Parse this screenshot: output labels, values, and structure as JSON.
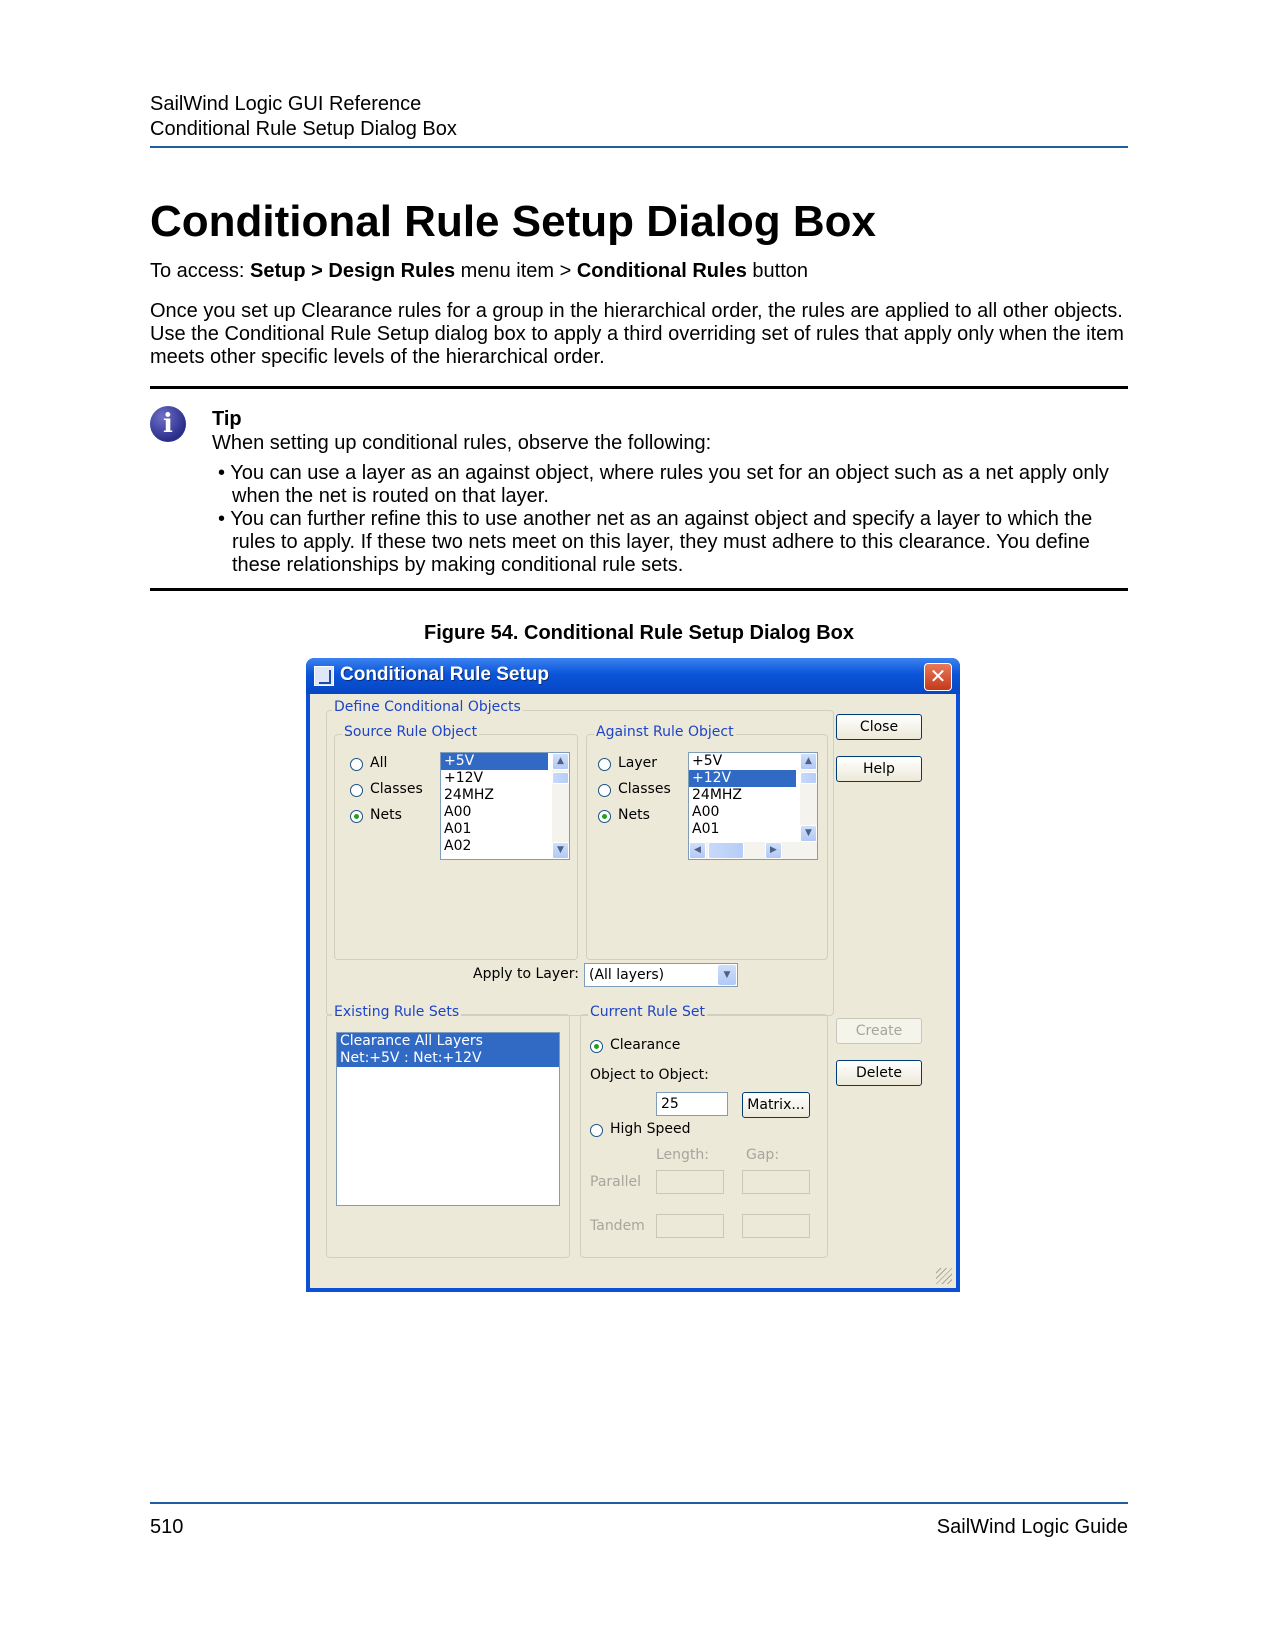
{
  "header": {
    "line1": "SailWind Logic GUI Reference",
    "line2": "Conditional Rule Setup Dialog Box"
  },
  "page_title": "Conditional Rule Setup Dialog Box",
  "access": {
    "prefix": "To access: ",
    "path": "Setup > Design Rules",
    "mid": " menu item > ",
    "button": "Conditional Rules",
    "suffix": " button"
  },
  "intro": "Once you set up Clearance rules for a group in the hierarchical order, the rules are applied to all other objects. Use the Conditional Rule Setup dialog box to apply a third overriding set of rules that apply only when the item meets other specific levels of the hierarchical order.",
  "tip": {
    "icon": "info-icon",
    "title": "Tip",
    "text": "When setting up conditional rules, observe the following:",
    "bullets": [
      "• You can use a layer as an against object, where rules you set for an object such as a net apply only when the net is routed on that layer.",
      "• You can further refine this to use another net as an against object and specify a layer to which the rules to apply. If these two nets meet on this layer, they must adhere to this clearance. You define these relationships by making conditional rule sets."
    ]
  },
  "figure_caption": "Figure 54. Conditional Rule Setup Dialog Box",
  "dialog": {
    "title": "Conditional Rule Setup",
    "close_glyph": "✕",
    "define_group": "Define Conditional Objects",
    "source_group": "Source Rule Object",
    "source_radios": [
      "All",
      "Classes",
      "Nets"
    ],
    "source_selected": "Nets",
    "source_list": [
      "+5V",
      "+12V",
      "24MHZ",
      "A00",
      "A01",
      "A02"
    ],
    "source_list_selected": "+5V",
    "against_group": "Against Rule Object",
    "against_radios": [
      "Layer",
      "Classes",
      "Nets"
    ],
    "against_selected": "Nets",
    "against_list": [
      "+5V",
      "+12V",
      "24MHZ",
      "A00",
      "A01"
    ],
    "against_list_selected": "+12V",
    "apply_layer_label": "Apply to Layer:",
    "apply_layer_value": "(All layers)",
    "existing_group": "Existing Rule Sets",
    "existing_list": [
      "Clearance All Layers",
      "Net:+5V : Net:+12V"
    ],
    "current_group": "Current Rule Set",
    "clearance_label": "Clearance",
    "object_to_object_label": "Object to Object:",
    "object_to_object_value": "25",
    "matrix_button": "Matrix...",
    "high_speed_label": "High Speed",
    "length_label": "Length:",
    "gap_label": "Gap:",
    "parallel_label": "Parallel",
    "tandem_label": "Tandem",
    "buttons": {
      "close": "Close",
      "help": "Help",
      "create": "Create",
      "delete": "Delete"
    }
  },
  "footer": {
    "page_number": "510",
    "guide": "SailWind Logic Guide"
  },
  "colors": {
    "header_rule": "#1f5fa0",
    "titlebar": "#0a55d8",
    "dialog_face": "#ece9d8",
    "group_label": "#1d44c9",
    "selection": "#316ac5"
  }
}
